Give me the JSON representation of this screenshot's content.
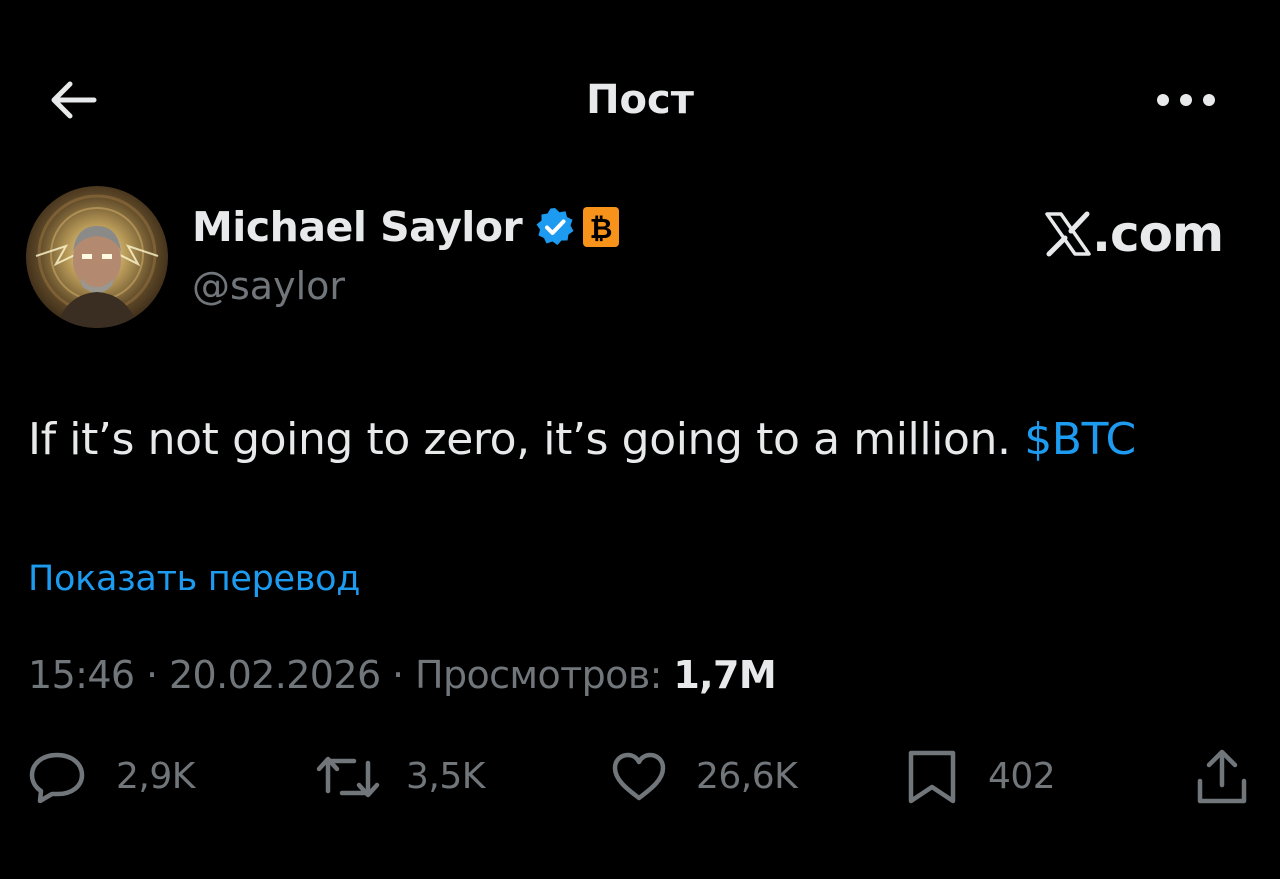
{
  "header": {
    "title": "Пост",
    "back_icon": "arrow-left-icon",
    "more_icon": "more-horizontal-icon"
  },
  "author": {
    "display_name": "Michael Saylor",
    "handle": "@saylor",
    "verified_icon": "verified-badge-icon",
    "affiliate_icon": "bitcoin-badge-icon",
    "verified_color": "#1d9bf0",
    "badge_color": "#f7931a"
  },
  "watermark": {
    "text": ".com",
    "icon": "x-logo-icon"
  },
  "tweet": {
    "text": "If it’s not going to zero, it’s going to a million. ",
    "cashtag": "$BTC"
  },
  "translate_link": "Показать перевод",
  "meta": {
    "time": "15:46",
    "separator": " · ",
    "date": "20.02.2026",
    "views_label": "Просмотров: ",
    "views_count": "1,7M"
  },
  "actions": {
    "replies": {
      "icon": "reply-icon",
      "count": "2,9K"
    },
    "reposts": {
      "icon": "repost-icon",
      "count": "3,5K"
    },
    "likes": {
      "icon": "heart-icon",
      "count": "26,6K"
    },
    "bookmarks": {
      "icon": "bookmark-icon",
      "count": "402"
    },
    "share": {
      "icon": "share-icon"
    }
  },
  "colors": {
    "background": "#000000",
    "text_primary": "#e7e9ea",
    "text_secondary": "#71767b",
    "accent": "#1d9bf0"
  }
}
